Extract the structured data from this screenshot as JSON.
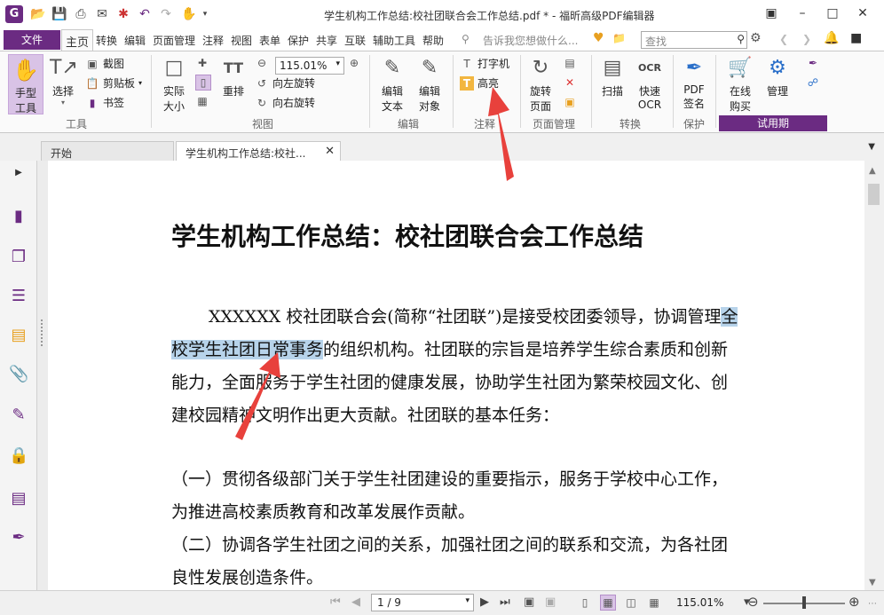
{
  "window": {
    "title": "学生机构工作总结:校社团联合会工作总结.pdf * - 福昕高级PDF编辑器",
    "logo_letter": "G"
  },
  "menu": {
    "file": "文件",
    "tabs": [
      "主页",
      "转换",
      "编辑",
      "页面管理",
      "注释",
      "视图",
      "表单",
      "保护",
      "共享",
      "互联",
      "辅助工具",
      "帮助"
    ],
    "tell_me": "告诉我您想做什么...",
    "search_placeholder": "查找"
  },
  "ribbon": {
    "hand_tool": "手型\n工具",
    "hand_tool_l1": "手型",
    "hand_tool_l2": "工具",
    "select": "选择",
    "screenshot": "截图",
    "clipboard": "剪贴板",
    "bookmark": "书签",
    "group_tools": "工具",
    "actual_size_l1": "实际",
    "actual_size_l2": "大小",
    "reflow": "重排",
    "zoom_value": "115.01%",
    "rotate_left": "向左旋转",
    "rotate_right": "向右旋转",
    "group_view": "视图",
    "edit_text_l1": "编辑",
    "edit_text_l2": "文本",
    "edit_object_l1": "编辑",
    "edit_object_l2": "对象",
    "group_edit": "编辑",
    "typewriter": "打字机",
    "highlight": "高亮",
    "group_comment": "注释",
    "rotate_page_l1": "旋转",
    "rotate_page_l2": "页面",
    "group_page": "页面管理",
    "scan": "扫描",
    "quick_ocr_l1": "快速",
    "quick_ocr_l2": "OCR",
    "group_convert": "转换",
    "pdf_sign_l1": "PDF",
    "pdf_sign_l2": "签名",
    "group_protect": "保护",
    "buy_online_l1": "在线",
    "buy_online_l2": "购买",
    "manage": "管理",
    "group_trial": "试用期"
  },
  "tabs": {
    "start": "开始",
    "document": "学生机构工作总结:校社..."
  },
  "document": {
    "title": "学生机构工作总结：校社团联合会工作总结",
    "p1_before": "XXXXXX 校社团联合会(简称“社团联”)是接受校团委领导，协调管理",
    "p1_highlight": "全校学生社团日常事务",
    "p1_after": "的组织机构。社团联的宗旨是培养学生综合素质和创新能力，全面服务于学生社团的健康发展，协助学生社团为繁荣校园文化、创建校园精神文明作出更大贡献。社团联的基本任务：",
    "p2": "（一）贯彻各级部门关于学生社团建设的重要指示，服务于学校中心工作，为推进高校素质教育和改革发展作贡献。",
    "p3": "（二）协调各学生社团之间的关系，加强社团之间的联系和交流，为各社团良性发展创造条件。"
  },
  "status": {
    "page": "1 / 9",
    "zoom": "115.01%"
  },
  "colors": {
    "brand": "#6b2b82",
    "highlight": "#b7d3ea",
    "arrow": "#e8413c"
  }
}
